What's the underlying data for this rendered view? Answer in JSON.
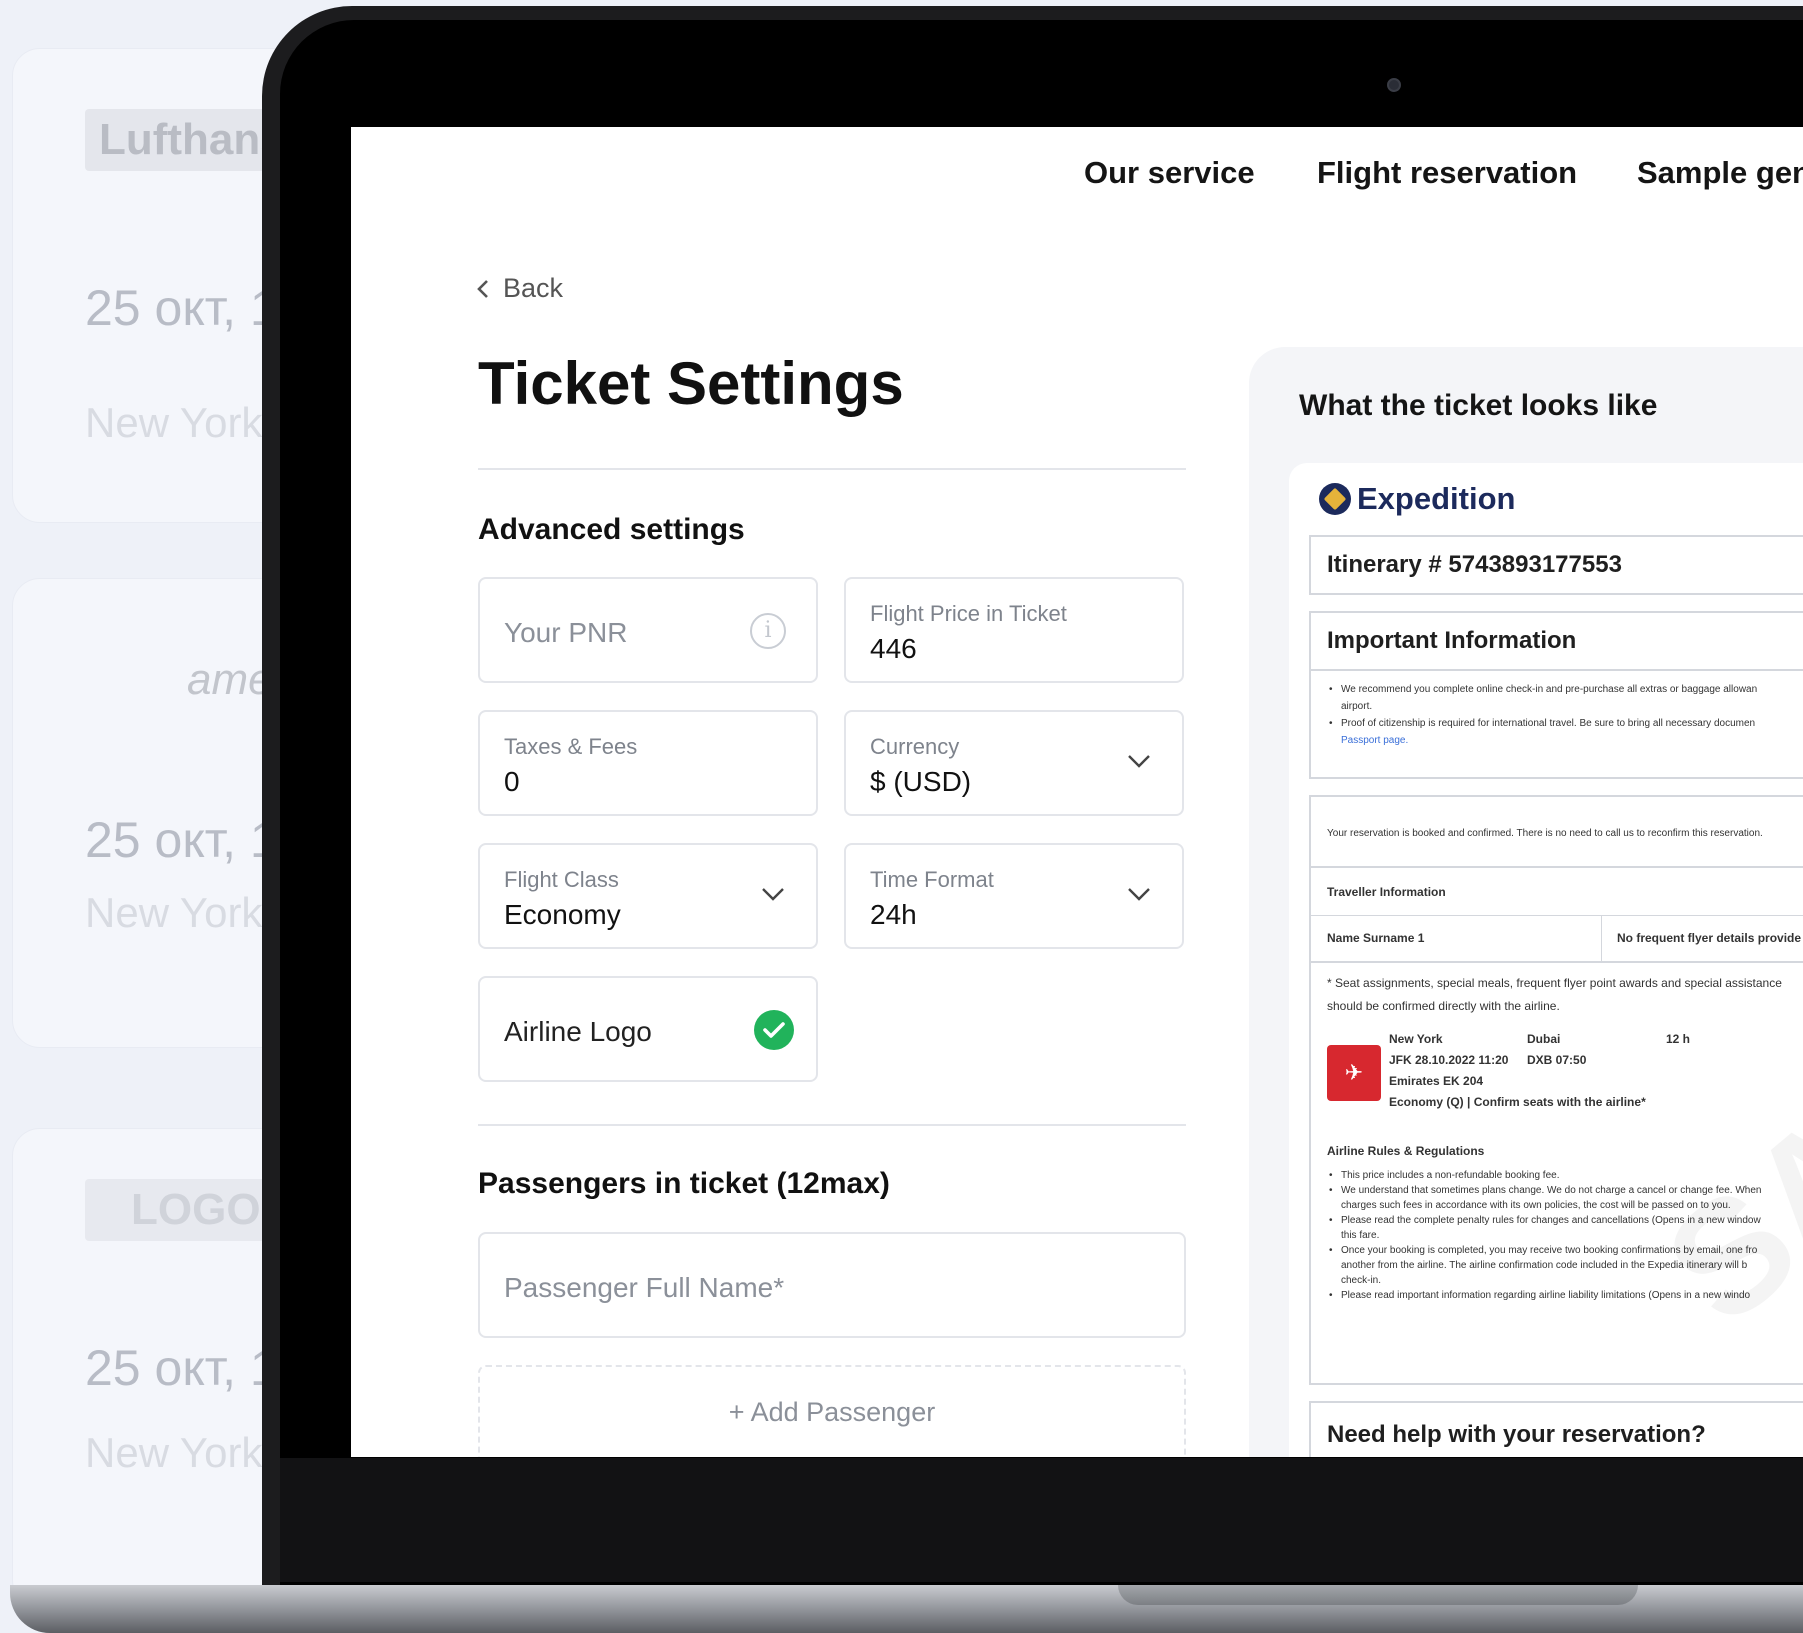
{
  "background_cards": [
    {
      "airline": "Lufthans",
      "date": "25 окт, 1",
      "city": "New York"
    },
    {
      "airline": "ameri",
      "date": "25 окт, 1",
      "city": "New York"
    },
    {
      "airline": "LOGO",
      "date": "25 окт, 1",
      "city": "New York"
    }
  ],
  "nav": {
    "items": [
      "Our service",
      "Flight reservation",
      "Sample gene"
    ]
  },
  "back_label": "Back",
  "page_title": "Ticket Settings",
  "advanced": {
    "heading": "Advanced settings",
    "pnr_placeholder": "Your PNR",
    "flight_price_label": "Flight Price in Ticket",
    "flight_price_value": "446",
    "taxes_label": "Taxes & Fees",
    "taxes_value": "0",
    "currency_label": "Currency",
    "currency_value": "$ (USD)",
    "class_label": "Flight Class",
    "class_value": "Economy",
    "time_label": "Time Format",
    "time_value": "24h",
    "logo_label": "Airline Logo"
  },
  "passengers": {
    "heading": "Passengers in ticket (12max)",
    "name_placeholder": "Passenger Full Name*",
    "add_label": "+ Add Passenger"
  },
  "preview": {
    "title": "What the ticket looks like",
    "brand": "Expedition",
    "itinerary": "Itinerary # 5743893177553",
    "important_heading": "Important Information",
    "important_1": "We recommend you complete online check-in and pre-purchase all extras or baggage allowan",
    "important_1b": "airport.",
    "important_2": "Proof of citizenship is required for international travel. Be sure to bring all necessary documen",
    "important_2_link": "Passport page.",
    "confirmed": "Your reservation is booked and confirmed. There is no need to call us to reconfirm this reservation.",
    "traveller_heading": "Traveller Information",
    "traveller_name": "Name Surname 1",
    "frequent_flyer": "No frequent flyer details provide",
    "seat_note_1": "* Seat assignments, special meals, frequent flyer point awards and special assistance",
    "seat_note_2": "should be confirmed directly with the airline.",
    "from_city": "New York",
    "to_city": "Dubai",
    "duration": "12 h",
    "depart": "JFK 28.10.2022 11:20",
    "arrive": "DXB 07:50",
    "flight": "Emirates EK 204",
    "class_line": "Economy (Q) | Confirm seats with the airline*",
    "rules_heading": "Airline Rules & Regulations",
    "rules": [
      "This price includes a non-refundable booking fee.",
      "We understand that sometimes plans change. We do not charge a cancel or change fee. When",
      "charges such fees in accordance with its own policies, the cost will be passed on to you.",
      "Please read the complete penalty rules for changes and cancellations (Opens in a new window",
      "this fare.",
      "Once your booking is completed, you may receive two booking confirmations by email, one fro",
      "another from the airline. The airline confirmation code included in the Expedia itinerary will b",
      "check-in.",
      "Please read important information regarding airline liability limitations (Opens in a new windo"
    ],
    "help_heading": "Need help with your reservation?",
    "watermark": "SAM"
  }
}
